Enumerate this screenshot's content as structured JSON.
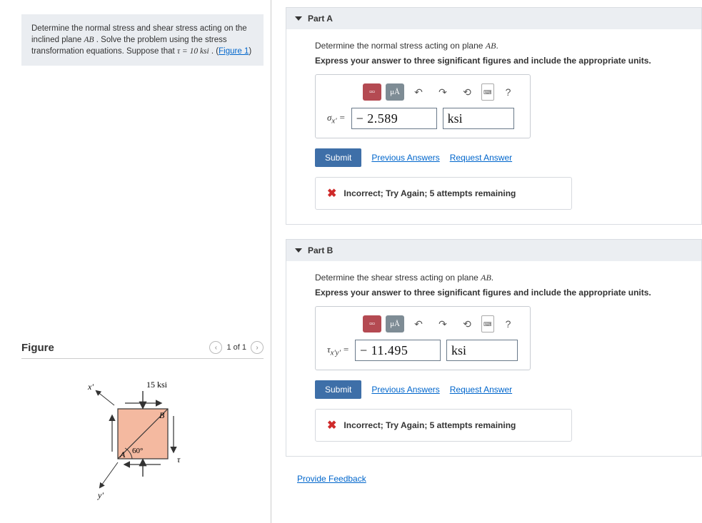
{
  "prompt": {
    "text_before": "Determine the normal stress and shear stress acting on the inclined plane ",
    "plane": "AB",
    "text_mid": ". Solve the problem using the stress transformation equations. Suppose that ",
    "tau_expr": "τ = 10 ksi",
    "text_after": " . (",
    "figure_link": "Figure 1",
    "close": ")"
  },
  "figure": {
    "title": "Figure",
    "pager": "1 of 1",
    "labels": {
      "top": "15 ksi",
      "x": "x'",
      "y": "y'",
      "A": "A",
      "B": "B",
      "angle": "60°",
      "tau": "τ"
    }
  },
  "partA": {
    "title": "Part A",
    "question_pre": "Determine the normal stress acting on plane ",
    "question_plane": "AB",
    "question_post": ".",
    "instruction": "Express your answer to three significant figures and include the appropriate units.",
    "var_html": "σ<sub>x'</sub> =",
    "value": "− 2.589",
    "units": "ksi",
    "submit": "Submit",
    "prev_answers": "Previous Answers",
    "request_answer": "Request Answer",
    "feedback": "Incorrect; Try Again; 5 attempts remaining"
  },
  "partB": {
    "title": "Part B",
    "question_pre": "Determine the shear stress acting on plane ",
    "question_plane": "AB",
    "question_post": ".",
    "instruction": "Express your answer to three significant figures and include the appropriate units.",
    "var_html": "τ<sub>x'y'</sub> =",
    "value": "− 11.495",
    "units": "ksi",
    "submit": "Submit",
    "prev_answers": "Previous Answers",
    "request_answer": "Request Answer",
    "feedback": "Incorrect; Try Again; 5 attempts remaining"
  },
  "toolbar": {
    "templates": "□",
    "units": "μÅ",
    "undo": "↶",
    "redo": "↷",
    "reset": "⟲",
    "keyboard": "⌨",
    "help": "?"
  },
  "links": {
    "provide_feedback": "Provide Feedback"
  }
}
